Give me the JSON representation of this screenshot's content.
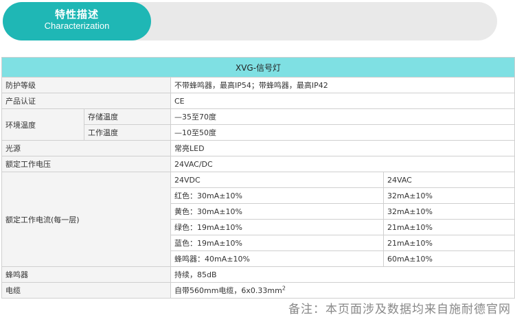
{
  "header": {
    "title": "特性描述",
    "subtitle": "Characterization"
  },
  "table": {
    "title": "XVG-信号灯",
    "protection": {
      "label": "防护等级",
      "value": "不带蜂鸣器，最高IP54；带蜂鸣器，最高IP42"
    },
    "certification": {
      "label": "产品认证",
      "value": "CE"
    },
    "environment": {
      "label": "环境温度",
      "storage": {
        "label": "存储温度",
        "value": "—35至70度"
      },
      "working": {
        "label": "工作温度",
        "value": "—10至50度"
      }
    },
    "light_source": {
      "label": "光源",
      "value": "常亮LED"
    },
    "rated_voltage": {
      "label": "额定工作电压",
      "value": "24VAC/DC"
    },
    "rated_current": {
      "label": "额定工作电流(每一层)",
      "col_dc": "24VDC",
      "col_ac": "24VAC",
      "rows": [
        {
          "dc": "红色：30mA±10%",
          "ac": "32mA±10%"
        },
        {
          "dc": "黄色：30mA±10%",
          "ac": "32mA±10%"
        },
        {
          "dc": "绿色：19mA±10%",
          "ac": "21mA±10%"
        },
        {
          "dc": "蓝色：19mA±10%",
          "ac": "21mA±10%"
        },
        {
          "dc": "蜂鸣器：40mA±10%",
          "ac": "60mA±10%"
        }
      ]
    },
    "buzzer": {
      "label": "蜂鸣器",
      "value": "持续，85dB"
    },
    "cable": {
      "label": "电缆",
      "value": "自带560mm电缆，6x0.33mm",
      "superscript": "2"
    }
  },
  "footer_note": "备注：本页面涉及数据均来自施耐德官网"
}
